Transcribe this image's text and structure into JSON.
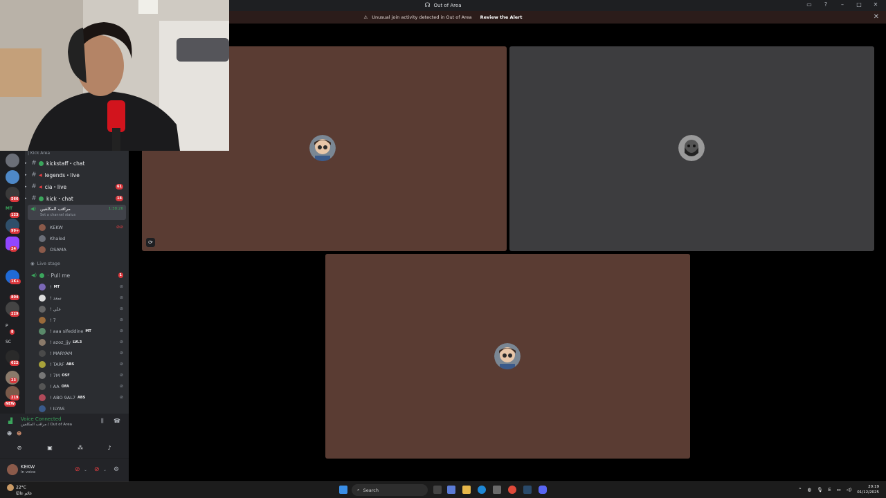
{
  "titlebar": {
    "title": "Out of Area"
  },
  "alert": {
    "message": "Unusual join activity detected in Out of Area",
    "action": "Review the Alert"
  },
  "sidebar": {
    "category": "| Kick Area",
    "text_channels": [
      {
        "name": "kickstaff・chat",
        "badge": ""
      },
      {
        "name": "legends・live",
        "badge": ""
      },
      {
        "name": "cia・live",
        "badge": "61"
      },
      {
        "name": "kick・chat",
        "badge": "14"
      }
    ],
    "voice_channel": {
      "name": "مراقب المكلفين",
      "timer": "1:38:26",
      "status": "Set a channel status",
      "users": [
        "KEKW",
        "Khaled",
        "OSAMA"
      ]
    },
    "stage": {
      "label": "Live stage",
      "channel": "Pull me",
      "channel_badge": "1",
      "users": [
        {
          "name": "!",
          "tag": "MT"
        },
        {
          "name": "! سعد",
          "tag": ""
        },
        {
          "name": "! علي",
          "tag": ""
        },
        {
          "name": "! 7",
          "tag": ""
        },
        {
          "name": "! aaa sifeddine",
          "tag": "MT"
        },
        {
          "name": "! azoz_jjy",
          "tag": "LVL3"
        },
        {
          "name": "! MARYAM",
          "tag": ""
        },
        {
          "name": "! TARF",
          "tag": "ABS"
        },
        {
          "name": "! 7M",
          "tag": "OSF"
        },
        {
          "name": "! AA",
          "tag": "OFA"
        },
        {
          "name": "! ABO 9AL7",
          "tag": "ABS"
        },
        {
          "name": "! ILYAS",
          "tag": ""
        }
      ]
    }
  },
  "server_rail": {
    "badges": [
      "566",
      "123",
      "99+",
      "24",
      "1K+",
      "804",
      "229",
      "8",
      "622",
      "23",
      "219"
    ],
    "new_label": "NEW",
    "text_items": [
      "MT",
      "P",
      "SC"
    ]
  },
  "voice_panel": {
    "status": "Voice Connected",
    "subtitle": "مراقب المكلفين / Out of Area"
  },
  "user_panel": {
    "name": "KEKW",
    "subtitle": "In voice"
  },
  "taskbar": {
    "weather_temp": "22°C",
    "weather_desc": "غائم غالبًا",
    "search_placeholder": "Search",
    "lang": "E",
    "time": "20:19",
    "date": "01/12/2025"
  }
}
